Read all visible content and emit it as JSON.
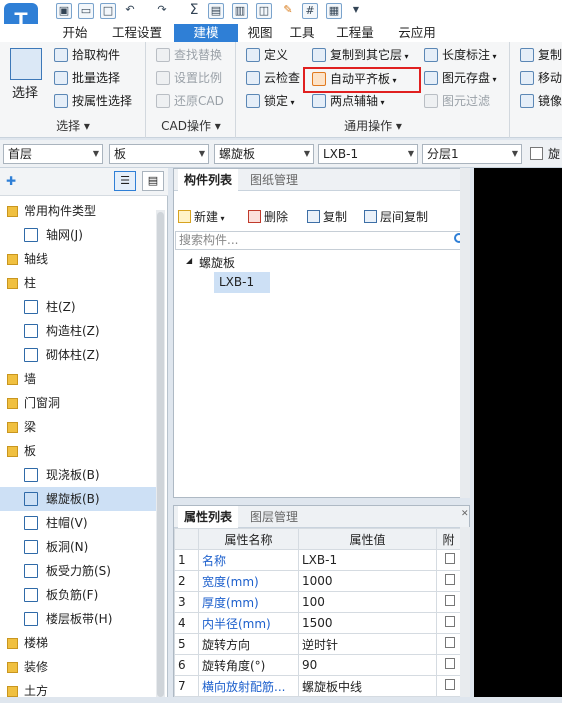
{
  "quickaccess": {
    "icons": [
      "save-icon",
      "folder-open-icon",
      "new-file-icon",
      "print-icon",
      "undo-icon",
      "redo-icon",
      "sum-icon",
      "report-icon",
      "calculator-icon",
      "layer-icon",
      "edit-icon",
      "grid-icon",
      "table-icon",
      "dropdown-icon"
    ],
    "sum_glyph": "Σ"
  },
  "tabs": [
    {
      "label": "开始"
    },
    {
      "label": "工程设置"
    },
    {
      "label": "建模"
    },
    {
      "label": "视图"
    },
    {
      "label": "工具"
    },
    {
      "label": "工程量"
    },
    {
      "label": "云应用"
    }
  ],
  "ribbon": {
    "select": {
      "label": "选择",
      "pick": "拾取构件",
      "batch": "批量选择",
      "byprop": "按属性选择",
      "group": "选择 ▾"
    },
    "cad": {
      "find_replace": "查找替换",
      "scale": "设置比例",
      "restore": "还原CAD",
      "group": "CAD操作 ▾"
    },
    "general": {
      "define": "定义",
      "copy_floor": "复制到其它层",
      "length_mark": "长度标注",
      "cloud_check": "云检查",
      "auto_flat": "自动平齐板",
      "element_save": "图元存盘",
      "lock": "锁定",
      "two_point_axis": "两点辅轴",
      "element_filter": "图元过滤",
      "group": "通用操作 ▾"
    },
    "modify": {
      "copy": "复制",
      "move": "移动",
      "mirror": "镜像"
    }
  },
  "filters": {
    "floor": "首层",
    "category": "板",
    "subtype": "螺旋板",
    "element": "LXB-1",
    "layer": "分层1",
    "rotate": "旋"
  },
  "tree": {
    "header": "常用构件类型",
    "items": [
      {
        "label": "轴网(J)",
        "indent": 1
      },
      {
        "label": "轴线",
        "indent": 0
      },
      {
        "label": "柱",
        "indent": 0
      },
      {
        "label": "柱(Z)",
        "indent": 1
      },
      {
        "label": "构造柱(Z)",
        "indent": 1
      },
      {
        "label": "砌体柱(Z)",
        "indent": 1
      },
      {
        "label": "墙",
        "indent": 0
      },
      {
        "label": "门窗洞",
        "indent": 0
      },
      {
        "label": "梁",
        "indent": 0
      },
      {
        "label": "板",
        "indent": 0
      },
      {
        "label": "现浇板(B)",
        "indent": 1
      },
      {
        "label": "螺旋板(B)",
        "indent": 1,
        "selected": true
      },
      {
        "label": "柱帽(V)",
        "indent": 1
      },
      {
        "label": "板洞(N)",
        "indent": 1
      },
      {
        "label": "板受力筋(S)",
        "indent": 1
      },
      {
        "label": "板负筋(F)",
        "indent": 1
      },
      {
        "label": "楼层板带(H)",
        "indent": 1
      },
      {
        "label": "楼梯",
        "indent": 0
      },
      {
        "label": "装修",
        "indent": 0
      },
      {
        "label": "土方",
        "indent": 0
      }
    ]
  },
  "complist": {
    "tab_active": "构件列表",
    "tab_inactive": "图纸管理",
    "new": "新建",
    "delete": "删除",
    "copy": "复制",
    "floor_copy": "层间复制",
    "search_placeholder": "搜索构件...",
    "group": "螺旋板",
    "item": "LXB-1"
  },
  "props": {
    "tab_active": "属性列表",
    "tab_inactive": "图层管理",
    "col_name": "属性名称",
    "col_value": "属性值",
    "col_attach": "附",
    "rows": [
      {
        "no": "1",
        "name": "名称",
        "value": "LXB-1",
        "blue": true
      },
      {
        "no": "2",
        "name": "宽度(mm)",
        "value": "1000",
        "blue": true
      },
      {
        "no": "3",
        "name": "厚度(mm)",
        "value": "100",
        "blue": true
      },
      {
        "no": "4",
        "name": "内半径(mm)",
        "value": "1500",
        "blue": true
      },
      {
        "no": "5",
        "name": "旋转方向",
        "value": "逆时针",
        "blue": false
      },
      {
        "no": "6",
        "name": "旋转角度(°)",
        "value": "90",
        "blue": false
      },
      {
        "no": "7",
        "name": "横向放射配筋...",
        "value": "螺旋板中线",
        "blue": true
      }
    ]
  },
  "colors": {
    "accent": "#2f7fd6",
    "highlight": "#e02020"
  }
}
